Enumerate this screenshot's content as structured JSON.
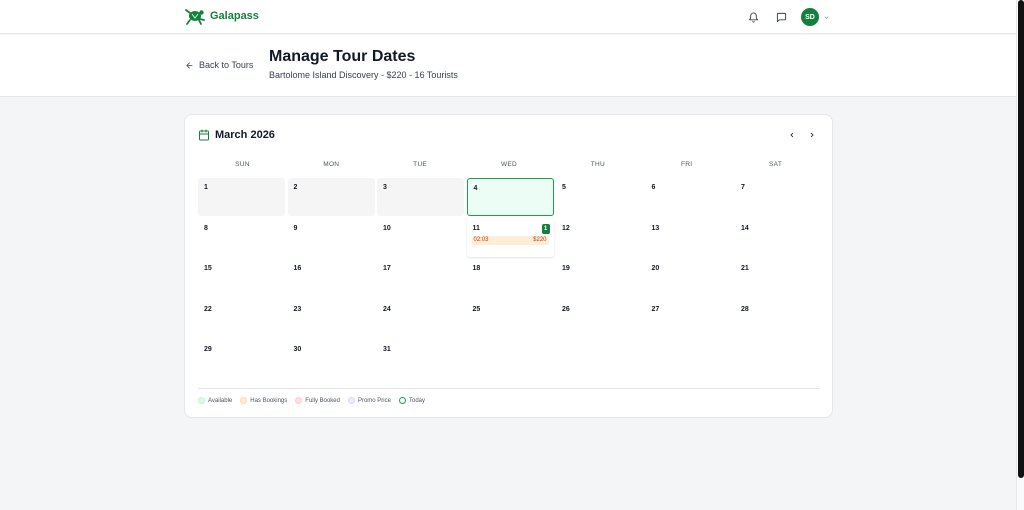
{
  "app": {
    "name": "Galapass"
  },
  "topbar": {
    "avatar_initials": "SD"
  },
  "header": {
    "back_label": "Back to Tours",
    "title": "Manage Tour Dates",
    "subtitle": "Bartolome Island Discovery - $220 - 16 Tourists"
  },
  "calendar": {
    "month": "March 2026",
    "weekdays": [
      "SUN",
      "MON",
      "TUE",
      "WED",
      "THU",
      "FRI",
      "SAT"
    ],
    "days": [
      {
        "n": "1",
        "state": "past"
      },
      {
        "n": "2",
        "state": "past"
      },
      {
        "n": "3",
        "state": "past"
      },
      {
        "n": "4",
        "state": "today"
      },
      {
        "n": "5"
      },
      {
        "n": "6"
      },
      {
        "n": "7"
      },
      {
        "n": "8"
      },
      {
        "n": "9"
      },
      {
        "n": "10"
      },
      {
        "n": "11",
        "state": "booked",
        "badge": "1",
        "slot_time": "02:03",
        "slot_price": "$220"
      },
      {
        "n": "12"
      },
      {
        "n": "13"
      },
      {
        "n": "14"
      },
      {
        "n": "15"
      },
      {
        "n": "16"
      },
      {
        "n": "17"
      },
      {
        "n": "18"
      },
      {
        "n": "19"
      },
      {
        "n": "20"
      },
      {
        "n": "21"
      },
      {
        "n": "22"
      },
      {
        "n": "23"
      },
      {
        "n": "24"
      },
      {
        "n": "25"
      },
      {
        "n": "26"
      },
      {
        "n": "27"
      },
      {
        "n": "28"
      },
      {
        "n": "29"
      },
      {
        "n": "30"
      },
      {
        "n": "31"
      }
    ],
    "legend": [
      {
        "label": "Available",
        "fill": "#dcfce7",
        "border": "#bbf7d0"
      },
      {
        "label": "Has Bookings",
        "fill": "#ffedd5",
        "border": "#fed7aa"
      },
      {
        "label": "Fully Booked",
        "fill": "#fee2e2",
        "border": "#fecaca"
      },
      {
        "label": "Promo Price",
        "fill": "#ede9fe",
        "border": "#ddd6fe"
      },
      {
        "label": "Today",
        "fill": "#ffffff",
        "border": "#16a34a"
      }
    ]
  },
  "colors": {
    "brand": "#15803d",
    "today_bg": "#ecfdf5",
    "slot_bg": "#ffedd5"
  }
}
